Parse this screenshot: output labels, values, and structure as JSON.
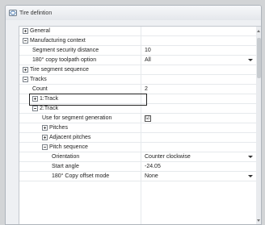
{
  "window": {
    "title": "Tire defintion",
    "icon": "tire-definition-icon"
  },
  "rows": [
    {
      "label": "General",
      "value": ""
    },
    {
      "label": "Manufacturing context",
      "value": ""
    },
    {
      "label": "Segment security distance",
      "value": "10"
    },
    {
      "label": "180° copy toolpath option",
      "value": "All"
    },
    {
      "label": "Tire segment sequence",
      "value": ""
    },
    {
      "label": "Tracks",
      "value": ""
    },
    {
      "label": "Count",
      "value": "2"
    },
    {
      "label": "1:Track",
      "value": ""
    },
    {
      "label": "2:Track",
      "value": ""
    },
    {
      "label": "Use for segment generation",
      "value": "☑"
    },
    {
      "label": "Pitches",
      "value": ""
    },
    {
      "label": "Adjacent pitches",
      "value": ""
    },
    {
      "label": "Pitch sequence",
      "value": ""
    },
    {
      "label": "Orientation",
      "value": "Counter clockwise"
    },
    {
      "label": "Start angle",
      "value": "-24.05"
    },
    {
      "label": "180° Copy offset mode",
      "value": "None"
    }
  ]
}
